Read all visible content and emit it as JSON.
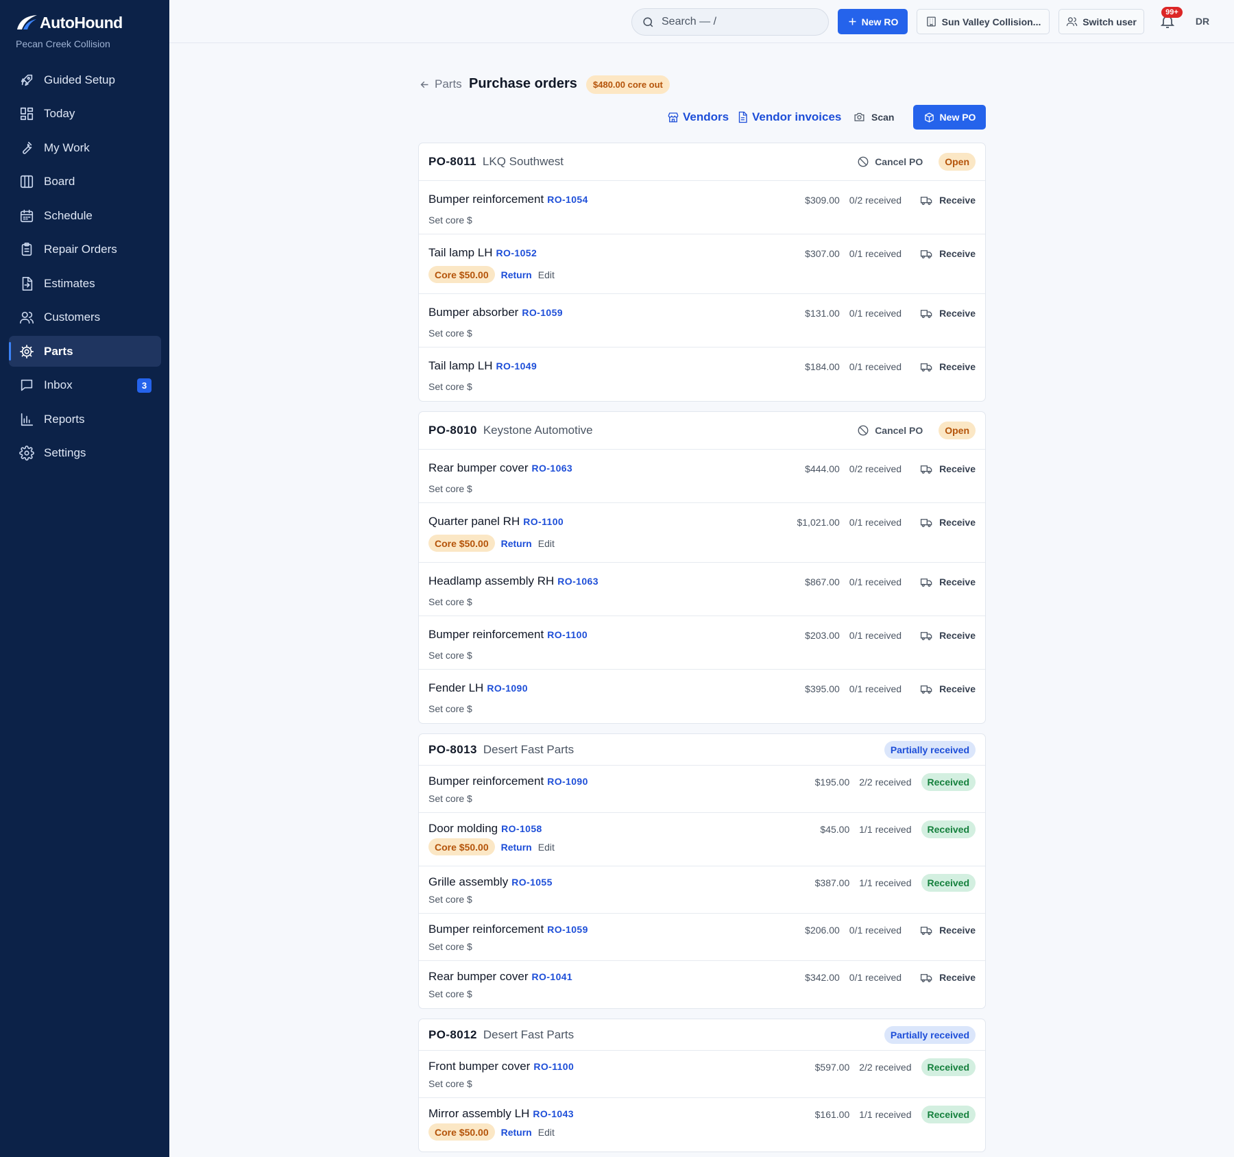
{
  "brand": {
    "name": "AutoHound",
    "shop": "Pecan Creek Collision"
  },
  "sidebar": {
    "items": [
      {
        "label": "Guided Setup",
        "icon": "rocket-icon"
      },
      {
        "label": "Today",
        "icon": "dashboard-icon"
      },
      {
        "label": "My Work",
        "icon": "wrench-icon"
      },
      {
        "label": "Board",
        "icon": "columns-icon"
      },
      {
        "label": "Schedule",
        "icon": "calendar-icon"
      },
      {
        "label": "Repair Orders",
        "icon": "clipboard-icon"
      },
      {
        "label": "Estimates",
        "icon": "file-arrow-icon"
      },
      {
        "label": "Customers",
        "icon": "users-icon"
      },
      {
        "label": "Parts",
        "icon": "gear-icon",
        "active": true
      },
      {
        "label": "Inbox",
        "icon": "chat-icon",
        "badge": "3"
      },
      {
        "label": "Reports",
        "icon": "bar-chart-icon"
      },
      {
        "label": "Settings",
        "icon": "settings-icon"
      }
    ]
  },
  "topbar": {
    "search_placeholder": "Search — /",
    "new_ro_label": "New RO",
    "shop_selector": "Sun Valley Collision...",
    "switch_user": "Switch user",
    "notification_count": "99+",
    "user_initials": "DR"
  },
  "page": {
    "back_label": "Parts",
    "title": "Purchase orders",
    "core_out_badge": "$480.00 core out",
    "actions": {
      "vendors": "Vendors",
      "vendor_invoices": "Vendor invoices",
      "scan": "Scan",
      "new_po": "New PO"
    }
  },
  "labels": {
    "cancel_po": "Cancel PO",
    "receive": "Receive",
    "received": "Received",
    "set_core": "Set core $",
    "return": "Return",
    "edit": "Edit"
  },
  "purchase_orders": [
    {
      "number": "PO-8011",
      "vendor": "LKQ Southwest",
      "status": "Open",
      "lines": [
        {
          "part": "Bumper reinforcement",
          "ro": "RO-1054",
          "price": "$309.00",
          "received": "0/2 received",
          "done": false
        },
        {
          "part": "Tail lamp LH",
          "ro": "RO-1052",
          "price": "$307.00",
          "received": "0/1 received",
          "done": false,
          "core": "Core $50.00"
        },
        {
          "part": "Bumper absorber",
          "ro": "RO-1059",
          "price": "$131.00",
          "received": "0/1 received",
          "done": false
        },
        {
          "part": "Tail lamp LH",
          "ro": "RO-1049",
          "price": "$184.00",
          "received": "0/1 received",
          "done": false
        }
      ]
    },
    {
      "number": "PO-8010",
      "vendor": "Keystone Automotive",
      "status": "Open",
      "lines": [
        {
          "part": "Rear bumper cover",
          "ro": "RO-1063",
          "price": "$444.00",
          "received": "0/2 received",
          "done": false
        },
        {
          "part": "Quarter panel RH",
          "ro": "RO-1100",
          "price": "$1,021.00",
          "received": "0/1 received",
          "done": false,
          "core": "Core $50.00"
        },
        {
          "part": "Headlamp assembly RH",
          "ro": "RO-1063",
          "price": "$867.00",
          "received": "0/1 received",
          "done": false
        },
        {
          "part": "Bumper reinforcement",
          "ro": "RO-1100",
          "price": "$203.00",
          "received": "0/1 received",
          "done": false
        },
        {
          "part": "Fender LH",
          "ro": "RO-1090",
          "price": "$395.00",
          "received": "0/1 received",
          "done": false
        }
      ]
    },
    {
      "number": "PO-8013",
      "vendor": "Desert Fast Parts",
      "status": "Partially received",
      "lines": [
        {
          "part": "Bumper reinforcement",
          "ro": "RO-1090",
          "price": "$195.00",
          "received": "2/2 received",
          "done": true
        },
        {
          "part": "Door molding",
          "ro": "RO-1058",
          "price": "$45.00",
          "received": "1/1 received",
          "done": true,
          "core": "Core $50.00"
        },
        {
          "part": "Grille assembly",
          "ro": "RO-1055",
          "price": "$387.00",
          "received": "1/1 received",
          "done": true
        },
        {
          "part": "Bumper reinforcement",
          "ro": "RO-1059",
          "price": "$206.00",
          "received": "0/1 received",
          "done": false
        },
        {
          "part": "Rear bumper cover",
          "ro": "RO-1041",
          "price": "$342.00",
          "received": "0/1 received",
          "done": false
        }
      ]
    },
    {
      "number": "PO-8012",
      "vendor": "Desert Fast Parts",
      "status": "Partially received",
      "lines": [
        {
          "part": "Front bumper cover",
          "ro": "RO-1100",
          "price": "$597.00",
          "received": "2/2 received",
          "done": true
        },
        {
          "part": "Mirror assembly LH",
          "ro": "RO-1043",
          "price": "$161.00",
          "received": "1/1 received",
          "done": true,
          "core": "Core $50.00"
        }
      ]
    }
  ],
  "colors": {
    "sidebar": "#0c2248",
    "primary": "#2563eb",
    "core": "#b45309",
    "received": "#15803d"
  }
}
